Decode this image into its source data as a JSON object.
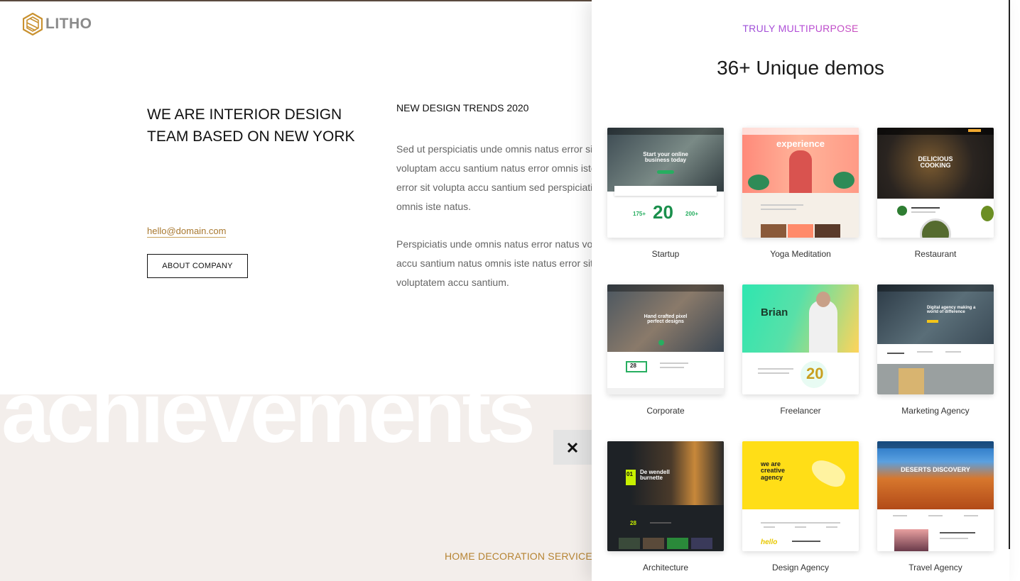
{
  "brand": {
    "logo_text": "LITHO",
    "accent": "#c9912f"
  },
  "about": {
    "title": "WE ARE INTERIOR DESIGN TEAM BASED ON NEW YORK",
    "email": "hello@domain.com",
    "button_label": "ABOUT COMPANY"
  },
  "trends": {
    "title": "NEW DESIGN TRENDS 2020",
    "paragraph1": "Sed ut perspiciatis unde omnis natus error sit\nvoluptam accu santium natus error omnis iste\nerror sit volupta accu santium sed perspiciatis\nomnis iste natus.",
    "paragraph2": "Perspiciatis unde omnis natus error natus volu\naccu santium natus omnis iste natus error sit\nvoluptatem accu santium."
  },
  "achievements": {
    "big_word": "achievements",
    "services_label": "HOME DECORATION SERVICES"
  },
  "close": {
    "icon": "close-icon"
  },
  "demo_panel": {
    "kicker": "TRULY MULTIPURPOSE",
    "title": "36+ Unique demos",
    "demos": [
      {
        "name": "Startup",
        "headline": "Start your online business today",
        "stat1": "175+",
        "stat2": "20",
        "stat3": "200+"
      },
      {
        "name": "Yoga Meditation",
        "headline": "experience"
      },
      {
        "name": "Restaurant",
        "headline": "DELICIOUS COOKING"
      },
      {
        "name": "Corporate",
        "headline": "Hand crafted pixel perfect designs",
        "stat1": "28"
      },
      {
        "name": "Freelancer",
        "headline": "Brian",
        "stat1": "20"
      },
      {
        "name": "Marketing Agency",
        "headline": "Digital agency making a world of difference"
      },
      {
        "name": "Architecture",
        "headline": "De wendell burnette",
        "stat1": "01",
        "stat2": "28"
      },
      {
        "name": "Design Agency",
        "headline": "we are creative agency",
        "footer": "hello"
      },
      {
        "name": "Travel Agency",
        "headline": "DESERTS DISCOVERY"
      }
    ]
  }
}
